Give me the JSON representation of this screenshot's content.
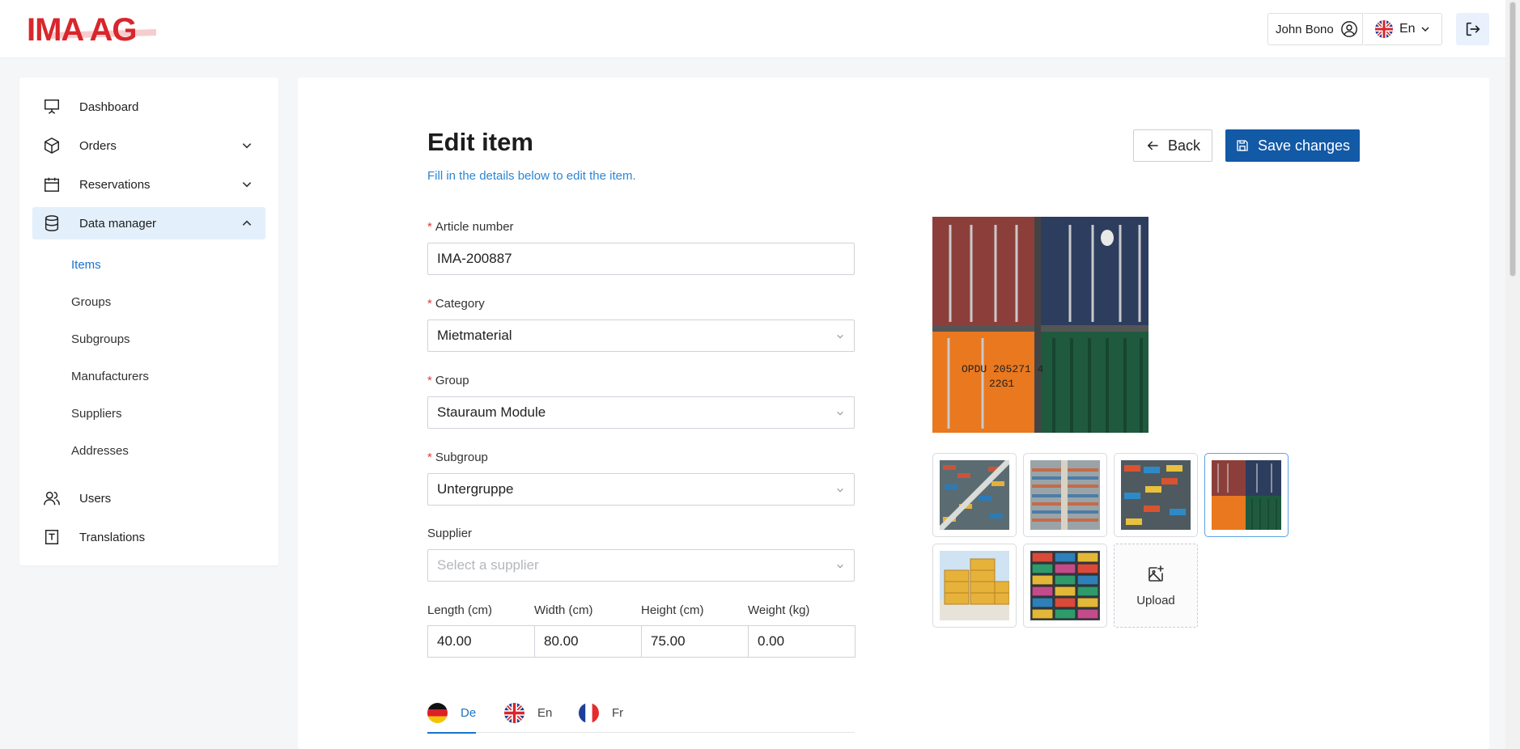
{
  "brand": {
    "logo_text": "IMA AG",
    "accent": "#1259a6",
    "logo_color": "#d8262c"
  },
  "header": {
    "user_name": "John Bono",
    "language": "En"
  },
  "sidebar": {
    "items": [
      {
        "label": "Dashboard",
        "icon": "presentation-icon"
      },
      {
        "label": "Orders",
        "icon": "box-icon"
      },
      {
        "label": "Reservations",
        "icon": "calendar-icon"
      },
      {
        "label": "Data manager",
        "icon": "database-icon"
      },
      {
        "label": "Users",
        "icon": "users-icon"
      },
      {
        "label": "Translations",
        "icon": "translate-icon"
      }
    ],
    "data_manager_sub": [
      "Items",
      "Groups",
      "Subgroups",
      "Manufacturers",
      "Suppliers",
      "Addresses"
    ]
  },
  "page": {
    "title": "Edit item",
    "subtitle": "Fill in the details below to edit the item.",
    "back_label": "Back",
    "save_label": "Save changes"
  },
  "form": {
    "article_number": {
      "label": "Article number",
      "value": "IMA-200887"
    },
    "category": {
      "label": "Category",
      "value": "Mietmaterial"
    },
    "group": {
      "label": "Group",
      "value": "Stauraum Module"
    },
    "subgroup": {
      "label": "Subgroup",
      "value": "Untergruppe"
    },
    "supplier": {
      "label": "Supplier",
      "placeholder": "Select a supplier"
    },
    "length": {
      "label": "Length (cm)",
      "value": "40.00"
    },
    "width": {
      "label": "Width (cm)",
      "value": "80.00"
    },
    "height": {
      "label": "Height (cm)",
      "value": "75.00"
    },
    "weight": {
      "label": "Weight (kg)",
      "value": "0.00"
    }
  },
  "language_tabs": [
    {
      "label": "De",
      "active": true
    },
    {
      "label": "En",
      "active": false
    },
    {
      "label": "Fr",
      "active": false
    }
  ],
  "images": {
    "main_text_1": "OPDU 205271 4",
    "main_text_2": "22G1",
    "upload_label": "Upload"
  }
}
